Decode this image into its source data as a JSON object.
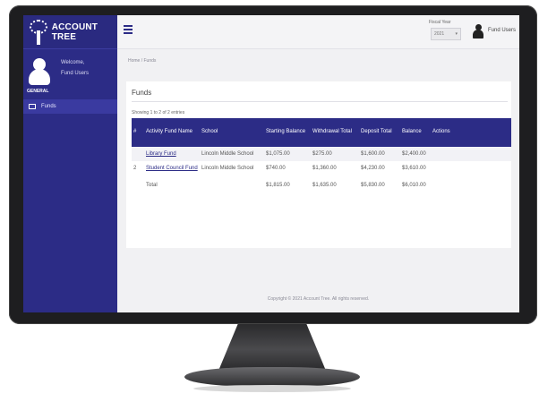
{
  "sidebar": {
    "brand": "ACCOUNT TREE",
    "welcome": "Welcome,",
    "username": "Fund Users",
    "role": "GENERAL",
    "menu": [
      {
        "label": "Funds"
      }
    ]
  },
  "header": {
    "year_label": "Fiscal Year",
    "year_value": "2021",
    "user_name": "Fund Users"
  },
  "breadcrumb": "Home / Funds",
  "panel": {
    "title": "Funds",
    "caption": "Showing 1 to 2 of 2 entries"
  },
  "table": {
    "headers": {
      "index": "#",
      "name": "Activity Fund Name",
      "school": "School",
      "starting": "Starting Balance",
      "withdrawal": "Withdrawal Total",
      "deposit": "Deposit Total",
      "balance": "Balance",
      "actions": "Actions"
    },
    "rows": [
      {
        "index": "",
        "name": "Library Fund",
        "school": "Lincoln Middle School",
        "starting": "$1,075.00",
        "withdrawal": "$275.00",
        "deposit": "$1,600.00",
        "balance": "$2,400.00",
        "actions": ""
      },
      {
        "index": "2",
        "name": "Student Council Fund",
        "school": "Lincoln Middle School",
        "starting": "$740.00",
        "withdrawal": "$1,360.00",
        "deposit": "$4,230.00",
        "balance": "$3,610.00",
        "actions": ""
      }
    ],
    "total": {
      "label": "Total",
      "starting": "$1,815.00",
      "withdrawal": "$1,635.00",
      "deposit": "$5,830.00",
      "balance": "$6,010.00"
    }
  },
  "footer": "Copyright © 2021 Account Tree. All rights reserved.",
  "colors": {
    "sidebar": "#2c2c86",
    "table_header": "#2c2c86",
    "content_bg": "#f1f1f3"
  },
  "icons": {
    "brand": "tree-icon",
    "avatar": "user-avatar-icon",
    "menu_toggle": "hamburger-icon",
    "top_user": "user-icon"
  }
}
